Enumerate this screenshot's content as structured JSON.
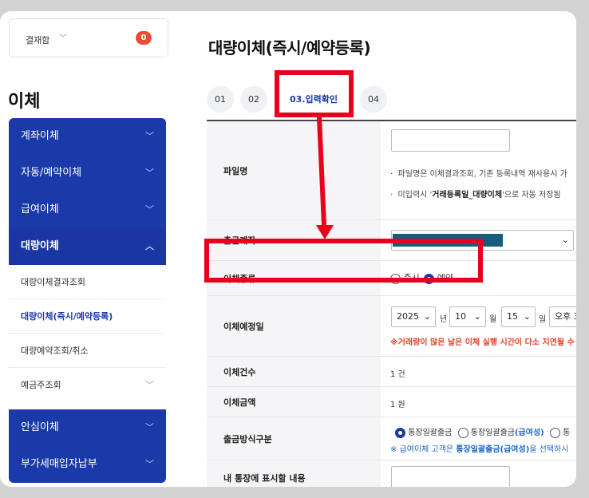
{
  "approval": {
    "label": "결재함",
    "count": "0"
  },
  "section_title": "이체",
  "sidebar": {
    "items": [
      {
        "label": "계좌이체"
      },
      {
        "label": "자동/예약이체"
      },
      {
        "label": "급여이체"
      },
      {
        "label": "대량이체"
      },
      {
        "label": "대량이체결과조회"
      },
      {
        "label": "대량이체(즉시/예약등록)"
      },
      {
        "label": "대량예약조회/취소"
      },
      {
        "label": "예금주조회"
      },
      {
        "label": "안심이체"
      },
      {
        "label": "부가세매입자납부"
      }
    ]
  },
  "page_title": "대량이체(즉시/예약등록)",
  "steps": [
    "01",
    "02",
    "03.입력확인",
    "04"
  ],
  "form": {
    "file_name": {
      "label": "파일명",
      "note1": "파일명은 이체결과조회, 기존 등록내역 재사용시 가",
      "note2_pre": "미입력시 '",
      "note2_bold": "거래등록일_대량이체",
      "note2_post": "'으로 자동 저장됨"
    },
    "account": {
      "label": "출금계좌"
    },
    "transfer_type": {
      "label": "이체종류",
      "opt_now": "즉시",
      "opt_reserve": "예약"
    },
    "schedule": {
      "label": "이체예정일",
      "year": "2025",
      "year_unit": "년",
      "month": "10",
      "month_unit": "월",
      "day": "15",
      "day_unit": "일",
      "time": "오후 3",
      "warning": "※거래량이 많은 날은 이체 실행 시간이 다소 지연될 수"
    },
    "count": {
      "label": "이체건수",
      "value": "1 건"
    },
    "amount": {
      "label": "이체금액",
      "value": "1 원"
    },
    "method": {
      "label": "출금방식구분",
      "opt1": "통장일괄출금",
      "opt2_pre": "통장일괄출금",
      "opt2_bold": "(급여성)",
      "opt3": "통",
      "note_pre": "※ 급여이체 고객은 ",
      "note_bold": "통장일괄출금(급여성)",
      "note_post": "을 선택하시"
    },
    "memo": {
      "label": "내 통장에 표시할 내용"
    }
  },
  "colors": {
    "nav_blue": "#1b3aa9",
    "highlight": "#e8001c",
    "badge": "#e94e34"
  }
}
